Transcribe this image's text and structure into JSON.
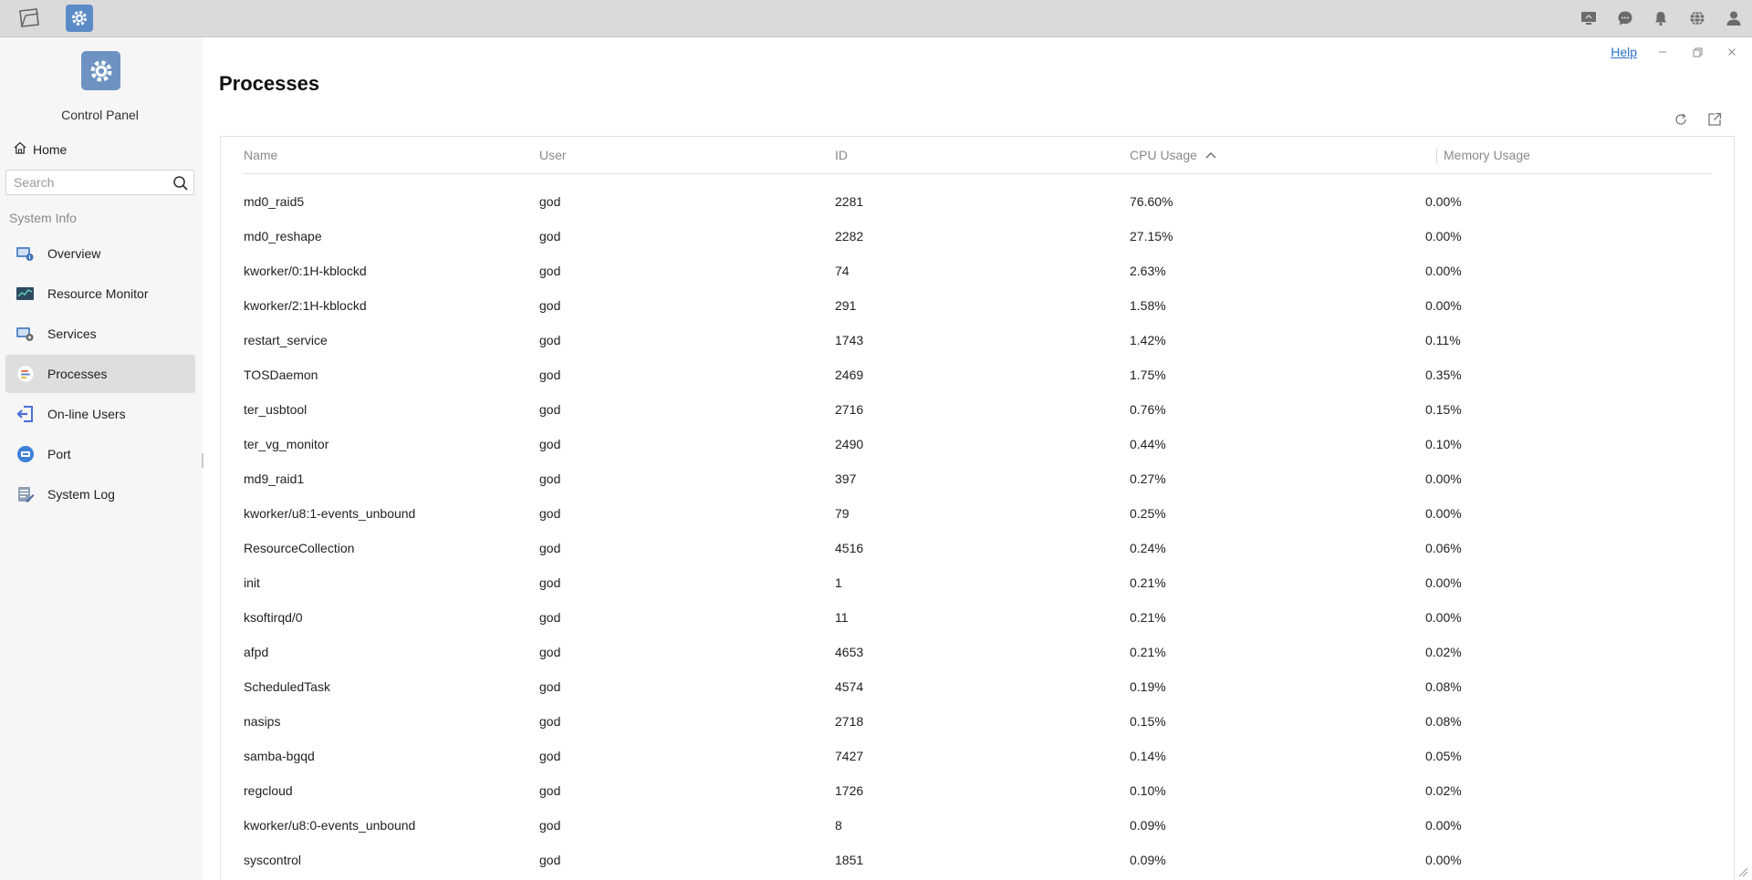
{
  "taskbar": {
    "desktop_icon": "show-desktop-icon",
    "app_icon": "control-panel-gear-icon",
    "right_icons": [
      "monitor-icon",
      "chat-icon",
      "bell-icon",
      "globe-icon",
      "user-icon"
    ]
  },
  "window": {
    "help_label": "Help"
  },
  "sidebar": {
    "app_title": "Control Panel",
    "home_label": "Home",
    "search_placeholder": "Search",
    "section_label": "System Info",
    "items": [
      {
        "label": "Overview",
        "icon": "overview-icon"
      },
      {
        "label": "Resource Monitor",
        "icon": "resource-monitor-icon"
      },
      {
        "label": "Services",
        "icon": "services-icon"
      },
      {
        "label": "Processes",
        "icon": "processes-icon",
        "active": true
      },
      {
        "label": "On-line Users",
        "icon": "online-users-icon"
      },
      {
        "label": "Port",
        "icon": "port-icon"
      },
      {
        "label": "System Log",
        "icon": "system-log-icon"
      }
    ]
  },
  "main": {
    "title": "Processes",
    "columns": {
      "name": "Name",
      "user": "User",
      "id": "ID",
      "cpu": "CPU Usage",
      "memory": "Memory Usage"
    },
    "sort": {
      "column": "CPU Usage",
      "direction": "ascending-indicator"
    },
    "rows": [
      {
        "name": "md0_raid5",
        "user": "god",
        "id": "2281",
        "cpu": "76.60%",
        "mem": "0.00%"
      },
      {
        "name": "md0_reshape",
        "user": "god",
        "id": "2282",
        "cpu": "27.15%",
        "mem": "0.00%"
      },
      {
        "name": "kworker/0:1H-kblockd",
        "user": "god",
        "id": "74",
        "cpu": "2.63%",
        "mem": "0.00%"
      },
      {
        "name": "kworker/2:1H-kblockd",
        "user": "god",
        "id": "291",
        "cpu": "1.58%",
        "mem": "0.00%"
      },
      {
        "name": "restart_service",
        "user": "god",
        "id": "1743",
        "cpu": "1.42%",
        "mem": "0.11%"
      },
      {
        "name": "TOSDaemon",
        "user": "god",
        "id": "2469",
        "cpu": "1.75%",
        "mem": "0.35%"
      },
      {
        "name": "ter_usbtool",
        "user": "god",
        "id": "2716",
        "cpu": "0.76%",
        "mem": "0.15%"
      },
      {
        "name": "ter_vg_monitor",
        "user": "god",
        "id": "2490",
        "cpu": "0.44%",
        "mem": "0.10%"
      },
      {
        "name": "md9_raid1",
        "user": "god",
        "id": "397",
        "cpu": "0.27%",
        "mem": "0.00%"
      },
      {
        "name": "kworker/u8:1-events_unbound",
        "user": "god",
        "id": "79",
        "cpu": "0.25%",
        "mem": "0.00%"
      },
      {
        "name": "ResourceCollection",
        "user": "god",
        "id": "4516",
        "cpu": "0.24%",
        "mem": "0.06%"
      },
      {
        "name": "init",
        "user": "god",
        "id": "1",
        "cpu": "0.21%",
        "mem": "0.00%"
      },
      {
        "name": "ksoftirqd/0",
        "user": "god",
        "id": "11",
        "cpu": "0.21%",
        "mem": "0.00%"
      },
      {
        "name": "afpd",
        "user": "god",
        "id": "4653",
        "cpu": "0.21%",
        "mem": "0.02%"
      },
      {
        "name": "ScheduledTask",
        "user": "god",
        "id": "4574",
        "cpu": "0.19%",
        "mem": "0.08%"
      },
      {
        "name": "nasips",
        "user": "god",
        "id": "2718",
        "cpu": "0.15%",
        "mem": "0.08%"
      },
      {
        "name": "samba-bgqd",
        "user": "god",
        "id": "7427",
        "cpu": "0.14%",
        "mem": "0.05%"
      },
      {
        "name": "regcloud",
        "user": "god",
        "id": "1726",
        "cpu": "0.10%",
        "mem": "0.02%"
      },
      {
        "name": "kworker/u8:0-events_unbound",
        "user": "god",
        "id": "8",
        "cpu": "0.09%",
        "mem": "0.00%"
      },
      {
        "name": "syscontrol",
        "user": "god",
        "id": "1851",
        "cpu": "0.09%",
        "mem": "0.00%"
      }
    ]
  },
  "colors": {
    "accent": "#2b72c9",
    "active_item_bg": "#dedede",
    "sidebar_bg": "#f6f6f6",
    "taskbar_bg": "#dadada"
  }
}
